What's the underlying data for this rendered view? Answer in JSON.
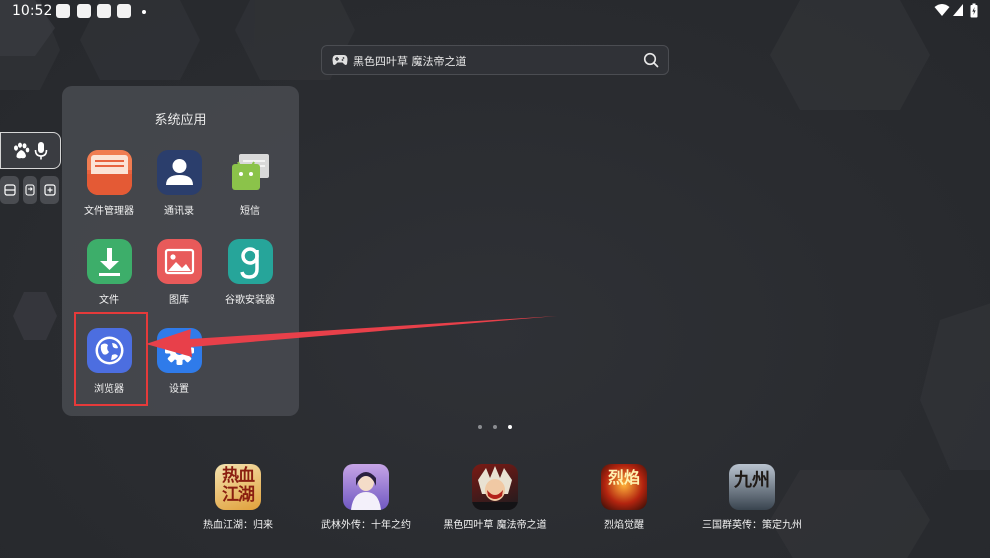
{
  "status_bar": {
    "time": "10:52",
    "notification_icons": [
      "square-icon",
      "square-icon",
      "square-icon",
      "square-icon",
      "dot-icon"
    ],
    "system_icons": [
      "wifi-icon",
      "cellular-signal-icon",
      "battery-icon"
    ]
  },
  "search": {
    "icon": "gamepad-icon",
    "text": "黑色四叶草 魔法帝之道",
    "action_icon": "search-icon"
  },
  "voice_widget": {
    "icons": [
      "baidu-paw-icon",
      "microphone-icon"
    ],
    "mini_icons": [
      "minus-box-icon",
      "swap-icon",
      "add-box-icon"
    ]
  },
  "folder": {
    "title": "系统应用",
    "apps": [
      {
        "label": "文件管理器",
        "icon": "file-manager-icon",
        "color": "#e8633f"
      },
      {
        "label": "通讯录",
        "icon": "contacts-icon",
        "color": "#2b3e6c"
      },
      {
        "label": "短信",
        "icon": "messages-icon",
        "color": "#8bc34a"
      },
      {
        "label": "文件",
        "icon": "download-icon",
        "color": "#3dae6a"
      },
      {
        "label": "图库",
        "icon": "gallery-icon",
        "color": "#e85a5a"
      },
      {
        "label": "谷歌安装器",
        "icon": "google-installer-icon",
        "color": "#26a59a"
      },
      {
        "label": "浏览器",
        "icon": "browser-globe-icon",
        "color": "#4c6ee0"
      },
      {
        "label": "设置",
        "icon": "settings-gear-icon",
        "color": "#2f7bea"
      }
    ]
  },
  "annotation": {
    "highlight_color": "#e53a3a",
    "arrow_color": "#e8404a"
  },
  "pager": {
    "count": 3,
    "active_index": 2
  },
  "dock": [
    {
      "label": "热血江湖：归来",
      "icon": "game-rexue-icon",
      "icon_text": "热血江湖"
    },
    {
      "label": "武林外传：十年之约",
      "icon": "game-wulin-icon"
    },
    {
      "label": "黑色四叶草 魔法帝之道",
      "icon": "game-black-clover-icon"
    },
    {
      "label": "烈焰觉醒",
      "icon": "game-lieyan-icon",
      "icon_text": "烈焰"
    },
    {
      "label": "三国群英传：策定九州",
      "icon": "game-sanguo-icon",
      "icon_text": "九州"
    }
  ]
}
